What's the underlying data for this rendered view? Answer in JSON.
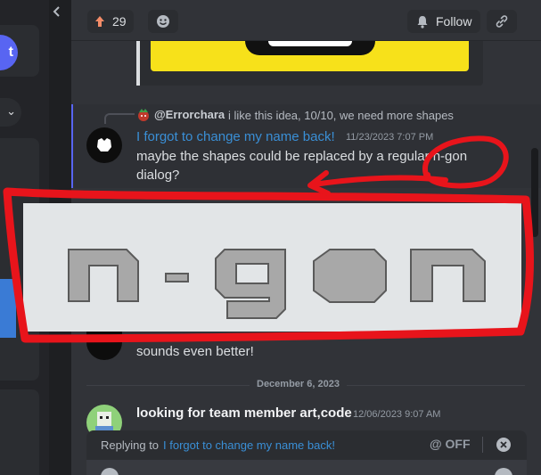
{
  "topbar": {
    "reaction_count": "29",
    "follow_label": "Follow"
  },
  "reply_preview": {
    "author": "@Errorchara",
    "text": "i like this idea, 10/10, we need more shapes"
  },
  "message1": {
    "author": "I forgot to change my name back!",
    "timestamp": "11/23/2023 7:07 PM",
    "line1": "maybe the shapes could be replaced by a regular n-gon",
    "line2": "dialog?"
  },
  "sticker": {
    "text": "n-gon"
  },
  "message2": {
    "text": "sounds even better!"
  },
  "divider": {
    "label": "December 6, 2023"
  },
  "message3": {
    "author": "looking for team member art,code",
    "timestamp": "12/06/2023 9:07 AM"
  },
  "replybar": {
    "prefix": "Replying to",
    "target": "I forgot to change my name back!",
    "mention_toggle": "@ OFF"
  },
  "colors": {
    "accent_blue": "#3a8fd6",
    "annotation_red": "#e8141b",
    "sticker_gray": "#a8a8a8"
  },
  "icons": [
    "upvote-arrow-icon",
    "emoji-add-icon",
    "bell-icon",
    "link-icon",
    "close-icon",
    "chevron-left-icon",
    "chevron-down-icon"
  ]
}
